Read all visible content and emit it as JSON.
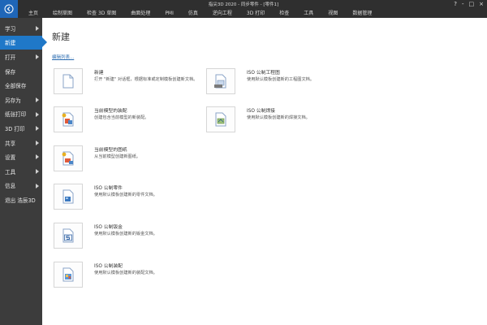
{
  "window": {
    "title": "指尖3D 2020 - 同步零件 - [零件1]",
    "controls": [
      "?",
      "-",
      "□",
      "×"
    ]
  },
  "ribbon": {
    "tabs": [
      "主页",
      "绘制草图",
      "检查 3D 草图",
      "曲面处理",
      "PMI",
      "仿真",
      "逆向工程",
      "3D 打印",
      "检查",
      "工具",
      "视图",
      "数据管理"
    ]
  },
  "sidebar": {
    "items": [
      {
        "label": "学习",
        "arrow": true,
        "active": false
      },
      {
        "label": "新建",
        "arrow": false,
        "active": true
      },
      {
        "label": "打开",
        "arrow": true,
        "active": false
      },
      {
        "label": "保存",
        "arrow": false,
        "active": false
      },
      {
        "label": "全部保存",
        "arrow": false,
        "active": false
      },
      {
        "label": "另存为",
        "arrow": true,
        "active": false
      },
      {
        "label": "纸张打印",
        "arrow": true,
        "active": false
      },
      {
        "label": "3D 打印",
        "arrow": true,
        "active": false
      },
      {
        "label": "共享",
        "arrow": true,
        "active": false
      },
      {
        "label": "设置",
        "arrow": true,
        "active": false
      },
      {
        "label": "工具",
        "arrow": true,
        "active": false
      },
      {
        "label": "信息",
        "arrow": true,
        "active": false
      },
      {
        "label": "退出 浩辰3D",
        "arrow": false,
        "active": false
      }
    ]
  },
  "main": {
    "title": "新建",
    "edit_link": "编辑列表...",
    "cards": [
      {
        "title": "新建",
        "desc": "打开 \"新建\" 对话框，根据标准或定制模板创建新文档。",
        "icon": "blank-document-icon"
      },
      {
        "title": "ISO 公制工程图",
        "desc": "使用默认模板创建新的工程图文档。",
        "icon": "iso-drawing-icon"
      },
      {
        "title": "当前模型的装配",
        "desc": "创建包含当前模型的新装配。",
        "icon": "assembly-from-model-icon"
      },
      {
        "title": "ISO 公制焊接",
        "desc": "使用默认模板创建新的焊接文档。",
        "icon": "iso-weldment-icon"
      },
      {
        "title": "当前模型的图纸",
        "desc": "从当前模型创建新图纸。",
        "icon": "drawing-from-model-icon"
      },
      {
        "title": "ISO 公制零件",
        "desc": "使用默认模板创建新的零件文档。",
        "icon": "iso-part-icon"
      },
      {
        "title": "ISO 公制钣金",
        "desc": "使用默认模板创建新的钣金文档。",
        "icon": "iso-sheet-metal-icon"
      },
      {
        "title": "ISO 公制装配",
        "desc": "使用默认模板创建新的装配文档。",
        "icon": "iso-assembly-icon"
      }
    ]
  },
  "colors": {
    "accent": "#1f78c8",
    "sidebar_bg": "#3c3c3c",
    "titlebar_bg": "#2f2f2f",
    "link": "#2a6bb0"
  }
}
